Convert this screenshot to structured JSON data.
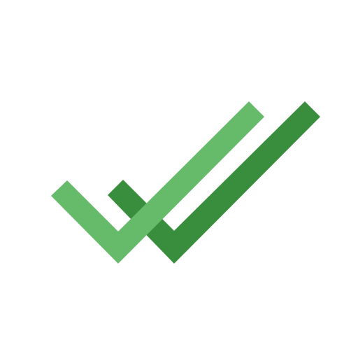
{
  "icon": {
    "name": "double-checkmark-icon",
    "colors": {
      "background": "#ffffff",
      "front_check": "#66bb6a",
      "back_check": "#388e3c"
    }
  }
}
